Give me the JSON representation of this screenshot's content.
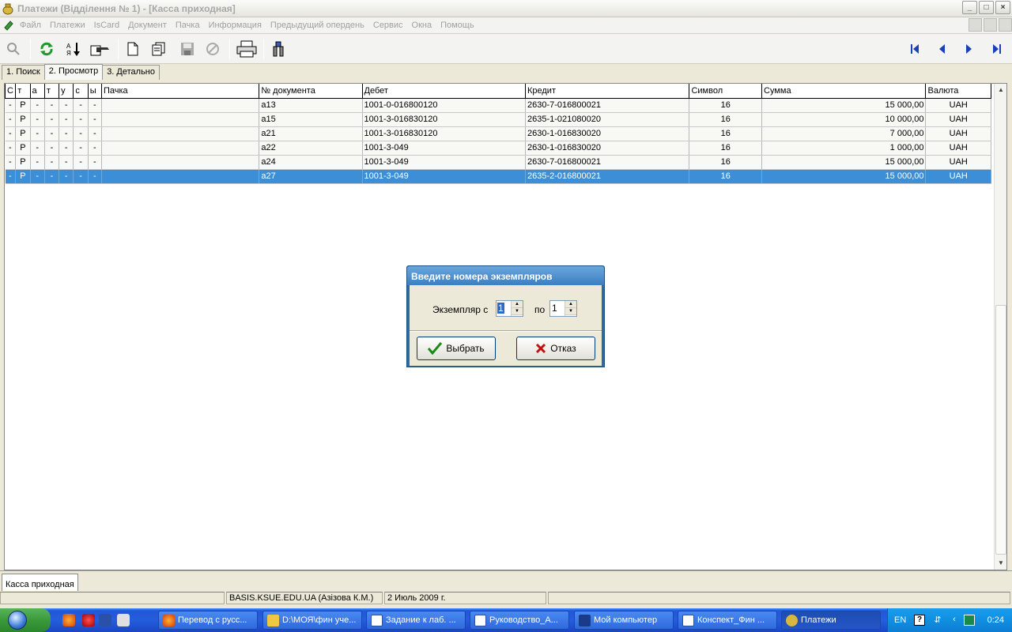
{
  "window": {
    "title": "Платежи (Відділення № 1) - [Касса приходная]",
    "controls": [
      "_",
      "□",
      "×"
    ]
  },
  "menu": {
    "items": [
      "Файл",
      "Платежи",
      "IsCard",
      "Документ",
      "Пачка",
      "Информация",
      "Предыдущий опердень",
      "Сервис",
      "Окна",
      "Помощь"
    ]
  },
  "toolbar": {
    "buttons": [
      "zoom-icon",
      "refresh-icon",
      "sort-icon",
      "export-hand-icon",
      "new-document-icon",
      "copy-document-icon",
      "save-icon",
      "cancel-icon",
      "print-icon",
      "tool-icon",
      "first-record-icon",
      "prev-record-icon",
      "next-record-icon",
      "last-record-icon"
    ]
  },
  "tabs": [
    {
      "label": "1. Поиск"
    },
    {
      "label": "2. Просмотр"
    },
    {
      "label": "3. Детально"
    }
  ],
  "grid": {
    "columns": [
      "С",
      "т",
      "а",
      "т",
      "у",
      "с",
      "ы",
      "Пачка",
      "№ документа",
      "Дебет",
      "Кредит",
      "Символ",
      "Сумма",
      "Валюта"
    ],
    "rows": [
      [
        "-",
        "Р",
        "-",
        "-",
        "-",
        "-",
        "-",
        "",
        "а13",
        "1001-0-016800120",
        "2630-7-016800021",
        "16",
        "15 000,00",
        "UAH"
      ],
      [
        "-",
        "Р",
        "-",
        "-",
        "-",
        "-",
        "-",
        "",
        "а15",
        "1001-3-016830120",
        "2635-1-021080020",
        "16",
        "10 000,00",
        "UAH"
      ],
      [
        "-",
        "Р",
        "-",
        "-",
        "-",
        "-",
        "-",
        "",
        "а21",
        "1001-3-016830120",
        "2630-1-016830020",
        "16",
        "7 000,00",
        "UAH"
      ],
      [
        "-",
        "Р",
        "-",
        "-",
        "-",
        "-",
        "-",
        "",
        "а22",
        "1001-3-049",
        "2630-1-016830020",
        "16",
        "1 000,00",
        "UAH"
      ],
      [
        "-",
        "Р",
        "-",
        "-",
        "-",
        "-",
        "-",
        "",
        "а24",
        "1001-3-049",
        "2630-7-016800021",
        "16",
        "15 000,00",
        "UAH"
      ],
      [
        "-",
        "Р",
        "-",
        "-",
        "-",
        "-",
        "-",
        "",
        "а27",
        "1001-3-049",
        "2635-2-016800021",
        "16",
        "15 000,00",
        "UAH"
      ]
    ],
    "selected_row": 5
  },
  "dialog": {
    "title": "Введите номера экземпляров",
    "from_label": "Экземпляр с",
    "from_value": "1",
    "to_label": "по",
    "to_value": "1",
    "ok_label": "Выбрать",
    "cancel_label": "Отказ"
  },
  "bottom_tab": "Касса приходная",
  "status": {
    "server": "BASIS.KSUE.EDU.UA (Азізова К.М.)",
    "date": "2 Июль 2009 г."
  },
  "taskbar": {
    "tasks": [
      {
        "label": "Перевод с русс..."
      },
      {
        "label": "D:\\МОЯ\\фин уче..."
      },
      {
        "label": "Задание к лаб. ..."
      },
      {
        "label": "Руководство_А..."
      },
      {
        "label": "Мой компьютер"
      },
      {
        "label": "Конспект_Фин ..."
      },
      {
        "label": "Платежи"
      }
    ],
    "lang": "EN",
    "clock": "0:24"
  },
  "colors": {
    "selection": "#3c8ed6",
    "dialog_title": "#3a7fc2",
    "taskbar": "#245edc"
  }
}
